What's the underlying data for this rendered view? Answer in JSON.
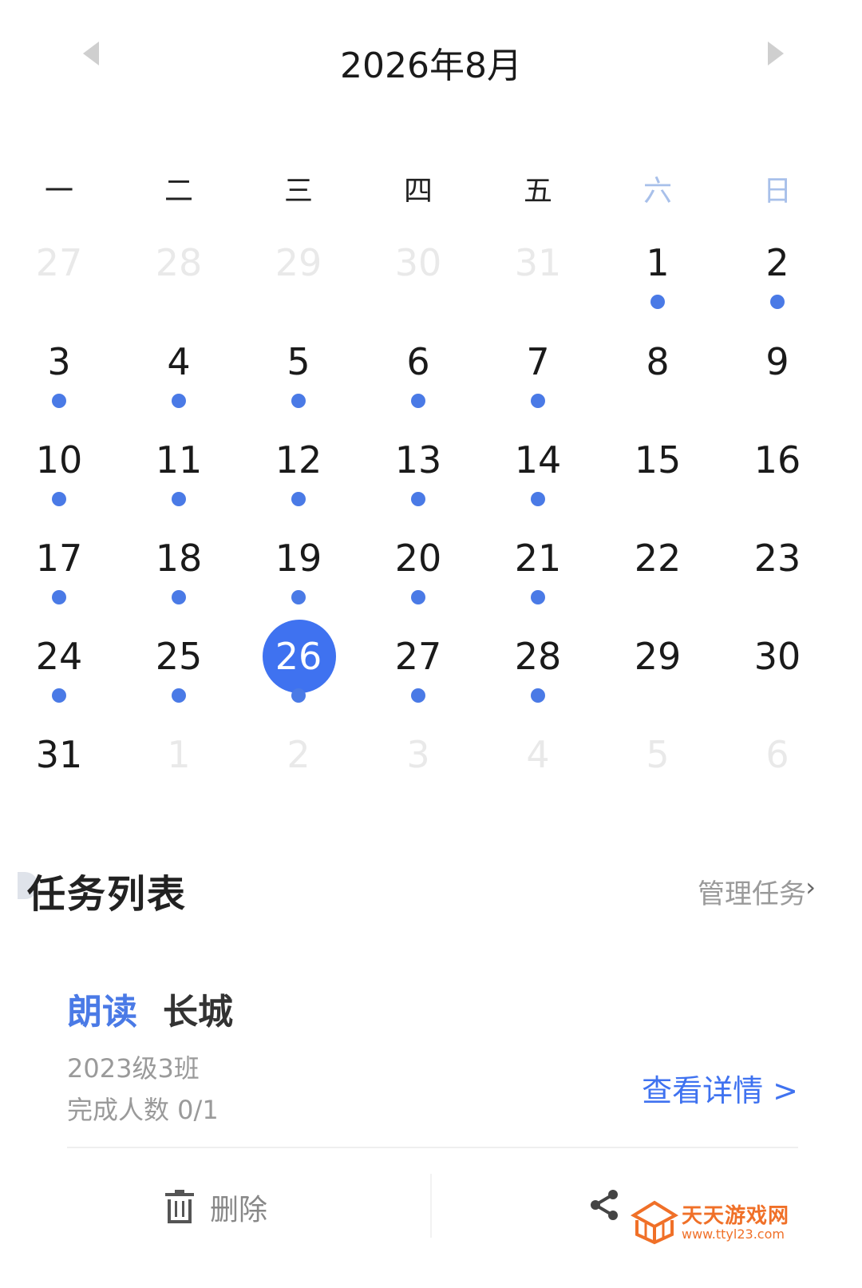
{
  "calendar": {
    "month_title": "2026年8月",
    "weekdays": [
      "一",
      "二",
      "三",
      "四",
      "五",
      "六",
      "日"
    ],
    "days": [
      {
        "label": "27",
        "in_month": false,
        "has_task": false,
        "selected": false
      },
      {
        "label": "28",
        "in_month": false,
        "has_task": false,
        "selected": false
      },
      {
        "label": "29",
        "in_month": false,
        "has_task": false,
        "selected": false
      },
      {
        "label": "30",
        "in_month": false,
        "has_task": false,
        "selected": false
      },
      {
        "label": "31",
        "in_month": false,
        "has_task": false,
        "selected": false
      },
      {
        "label": "1",
        "in_month": true,
        "has_task": true,
        "selected": false
      },
      {
        "label": "2",
        "in_month": true,
        "has_task": true,
        "selected": false
      },
      {
        "label": "3",
        "in_month": true,
        "has_task": true,
        "selected": false
      },
      {
        "label": "4",
        "in_month": true,
        "has_task": true,
        "selected": false
      },
      {
        "label": "5",
        "in_month": true,
        "has_task": true,
        "selected": false
      },
      {
        "label": "6",
        "in_month": true,
        "has_task": true,
        "selected": false
      },
      {
        "label": "7",
        "in_month": true,
        "has_task": true,
        "selected": false
      },
      {
        "label": "8",
        "in_month": true,
        "has_task": false,
        "selected": false
      },
      {
        "label": "9",
        "in_month": true,
        "has_task": false,
        "selected": false
      },
      {
        "label": "10",
        "in_month": true,
        "has_task": true,
        "selected": false
      },
      {
        "label": "11",
        "in_month": true,
        "has_task": true,
        "selected": false
      },
      {
        "label": "12",
        "in_month": true,
        "has_task": true,
        "selected": false
      },
      {
        "label": "13",
        "in_month": true,
        "has_task": true,
        "selected": false
      },
      {
        "label": "14",
        "in_month": true,
        "has_task": true,
        "selected": false
      },
      {
        "label": "15",
        "in_month": true,
        "has_task": false,
        "selected": false
      },
      {
        "label": "16",
        "in_month": true,
        "has_task": false,
        "selected": false
      },
      {
        "label": "17",
        "in_month": true,
        "has_task": true,
        "selected": false
      },
      {
        "label": "18",
        "in_month": true,
        "has_task": true,
        "selected": false
      },
      {
        "label": "19",
        "in_month": true,
        "has_task": true,
        "selected": false
      },
      {
        "label": "20",
        "in_month": true,
        "has_task": true,
        "selected": false
      },
      {
        "label": "21",
        "in_month": true,
        "has_task": true,
        "selected": false
      },
      {
        "label": "22",
        "in_month": true,
        "has_task": false,
        "selected": false
      },
      {
        "label": "23",
        "in_month": true,
        "has_task": false,
        "selected": false
      },
      {
        "label": "24",
        "in_month": true,
        "has_task": true,
        "selected": false
      },
      {
        "label": "25",
        "in_month": true,
        "has_task": true,
        "selected": false
      },
      {
        "label": "26",
        "in_month": true,
        "has_task": true,
        "selected": true
      },
      {
        "label": "27",
        "in_month": true,
        "has_task": true,
        "selected": false
      },
      {
        "label": "28",
        "in_month": true,
        "has_task": true,
        "selected": false
      },
      {
        "label": "29",
        "in_month": true,
        "has_task": false,
        "selected": false
      },
      {
        "label": "30",
        "in_month": true,
        "has_task": false,
        "selected": false
      },
      {
        "label": "31",
        "in_month": true,
        "has_task": false,
        "selected": false
      },
      {
        "label": "1",
        "in_month": false,
        "has_task": false,
        "selected": false
      },
      {
        "label": "2",
        "in_month": false,
        "has_task": false,
        "selected": false
      },
      {
        "label": "3",
        "in_month": false,
        "has_task": false,
        "selected": false
      },
      {
        "label": "4",
        "in_month": false,
        "has_task": false,
        "selected": false
      },
      {
        "label": "5",
        "in_month": false,
        "has_task": false,
        "selected": false
      },
      {
        "label": "6",
        "in_month": false,
        "has_task": false,
        "selected": false
      }
    ]
  },
  "task_list": {
    "title": "任务列表",
    "manage_label": "管理任务",
    "manage_chevron": "›"
  },
  "task": {
    "type": "朗读",
    "name": "长城",
    "class_name": "2023级3班",
    "progress": "完成人数 0/1",
    "detail_label": "查看详情 >"
  },
  "actions": {
    "delete_label": "删除"
  },
  "icons": {
    "prev": "chevron-left-icon",
    "next": "chevron-right-icon",
    "delete": "trash-icon",
    "share": "share-icon"
  },
  "colors": {
    "accent": "#3f72f0",
    "task_dot": "#4a7ae6",
    "weekend": "#a8c0ea",
    "muted_text": "#9a9a9a",
    "watermark": "#f07028"
  },
  "watermark": {
    "title": "天天游戏网",
    "url": "www.ttyl23.com"
  }
}
